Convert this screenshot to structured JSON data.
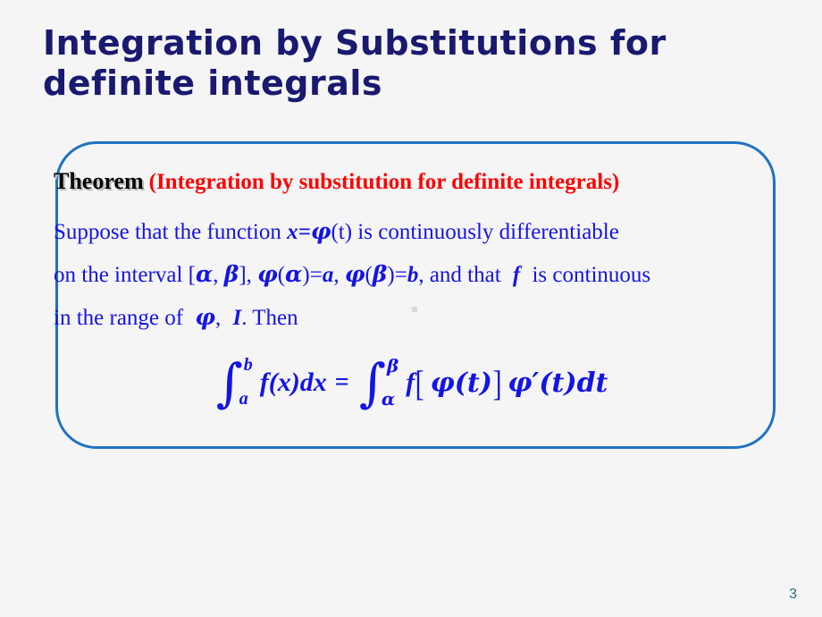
{
  "slide": {
    "page_number": "3",
    "background_color": "#f5f5f5",
    "title": "Integration by Substitutions for definite integrals",
    "title_color": "#191970"
  },
  "theorem_box": {
    "border_color": "#1F72C0",
    "header": {
      "label": "Theorem",
      "label_color": "#000000",
      "parenthetical": "(Integration by substitution for definite integrals)",
      "parenthetical_color": "#FF0000"
    },
    "body_color": "#1414E6",
    "lines": [
      {
        "id": "line-1",
        "text": "Suppose that the function x=φ(t) is continuously differentiable",
        "parts": [
          {
            "t": "Suppose that the function ",
            "style": "plain"
          },
          {
            "t": "x",
            "style": "bold-italic"
          },
          {
            "t": "=",
            "style": "bold-italic"
          },
          {
            "t": "φ",
            "style": "greek-bold-italic"
          },
          {
            "t": "(t) is continuously differentiable",
            "style": "plain"
          }
        ]
      },
      {
        "id": "line-2",
        "text": "on the interval [α, β], φ(α)=a, φ(β)=b, and that f is continuous",
        "parts": [
          {
            "t": "on the interval [",
            "style": "plain"
          },
          {
            "t": "α",
            "style": "greek-bold-italic"
          },
          {
            "t": ", ",
            "style": "plain"
          },
          {
            "t": "β",
            "style": "greek-bold-italic"
          },
          {
            "t": "], ",
            "style": "plain"
          },
          {
            "t": "φ",
            "style": "greek-bold-italic"
          },
          {
            "t": "(",
            "style": "plain"
          },
          {
            "t": "α",
            "style": "greek-bold-italic"
          },
          {
            "t": ")=",
            "style": "plain"
          },
          {
            "t": "a",
            "style": "bold-italic"
          },
          {
            "t": ", ",
            "style": "plain"
          },
          {
            "t": "φ",
            "style": "greek-bold-italic"
          },
          {
            "t": "(",
            "style": "plain"
          },
          {
            "t": "β",
            "style": "greek-bold-italic"
          },
          {
            "t": ")=",
            "style": "plain"
          },
          {
            "t": "b",
            "style": "bold-italic"
          },
          {
            "t": ", and that ",
            "style": "plain"
          },
          {
            "t": "f",
            "style": "bold-italic"
          },
          {
            "t": " is continuous",
            "style": "plain"
          }
        ]
      },
      {
        "id": "line-3",
        "text": "in the range of φ, I. Then",
        "parts": [
          {
            "t": "in the range of ",
            "style": "plain"
          },
          {
            "t": "φ",
            "style": "greek-bold-italic"
          },
          {
            "t": ", ",
            "style": "plain"
          },
          {
            "t": "I",
            "style": "bold-italic"
          },
          {
            "t": ". Then",
            "style": "plain"
          }
        ]
      }
    ],
    "formula": {
      "plain_text": "∫_a^b f(x)dx = ∫_α^β f[φ(t)]φ'(t)dt",
      "left": {
        "integral_sign": "∫",
        "lower_limit": "a",
        "upper_limit": "b",
        "integrand": "f(x)dx"
      },
      "equals": "=",
      "right": {
        "integral_sign": "∫",
        "lower_limit": "α",
        "upper_limit": "β",
        "integrand_f": "f",
        "bracket_open": "[",
        "inner": "φ(t)",
        "bracket_close": "]",
        "derivative": "φ′(t)dt"
      }
    }
  }
}
